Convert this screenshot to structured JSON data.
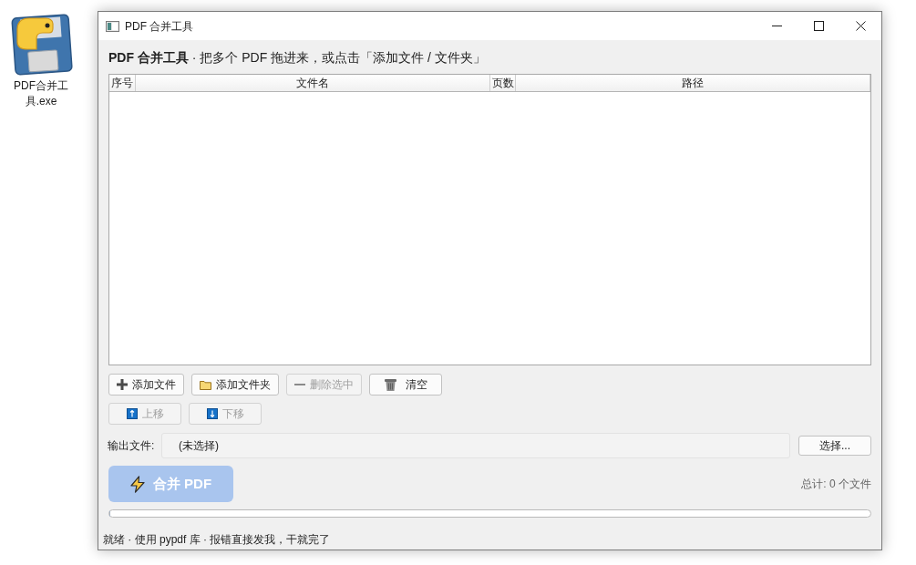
{
  "desktop_icon": {
    "label": "PDF合并工具.exe"
  },
  "window": {
    "title": "PDF 合并工具"
  },
  "header": {
    "text": "**PDF 合并工具** · 把多个 PDF 拖进来，或点击「添加文件 / 文件夹」"
  },
  "table": {
    "columns": [
      "序号",
      "文件名",
      "页数",
      "路径"
    ]
  },
  "file_buttons": [
    {
      "kind": "add",
      "label": "添加文件",
      "disabled": false
    },
    {
      "kind": "folder",
      "label": "添加文件夹",
      "disabled": false
    },
    {
      "kind": "remove",
      "label": "删除选中",
      "disabled": true
    },
    {
      "kind": "clear",
      "label": "清空",
      "disabled": false
    }
  ],
  "move_buttons": [
    {
      "kind": "up",
      "label": "上移",
      "disabled": true
    },
    {
      "kind": "down",
      "label": "下移",
      "disabled": true
    }
  ],
  "output": {
    "label": "输出文件:",
    "value": "(未选择)",
    "button": "选择..."
  },
  "merge_button": {
    "label": "合并 PDF",
    "disabled": true
  },
  "total": "总计: 0 个文件",
  "progress": {
    "level": 0
  },
  "status_bar": "就绪 · 使用 pypdf 库 · 报错直接发我，干就完了"
}
